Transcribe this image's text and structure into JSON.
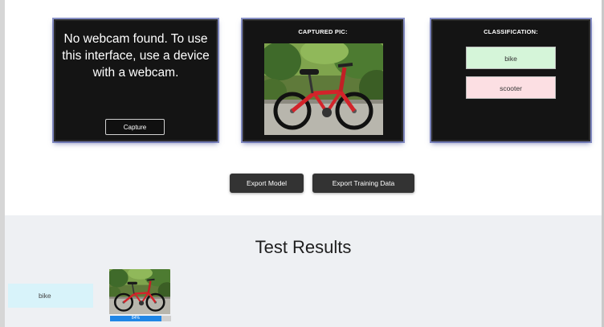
{
  "webcam_panel": {
    "message": "No webcam found. To use this interface, use a device with a webcam.",
    "capture_label": "Capture"
  },
  "captured_panel": {
    "title": "CAPTURED PIC:",
    "image_icon": "bicycle-photo"
  },
  "classification_panel": {
    "title": "CLASSIFICATION:",
    "classes": [
      {
        "label": "bike",
        "color": "#d5f5d9"
      },
      {
        "label": "scooter",
        "color": "#fcdfe3"
      }
    ]
  },
  "export": {
    "model_label": "Export Model",
    "training_data_label": "Export Training Data"
  },
  "test_results": {
    "title": "Test Results",
    "items": [
      {
        "label": "bike",
        "confidence_percent": 84,
        "confidence_text": "84%"
      }
    ]
  },
  "colors": {
    "panel_bg": "#141414",
    "results_bg": "#eef0f3",
    "confidence_bar": "#1f86e6"
  }
}
